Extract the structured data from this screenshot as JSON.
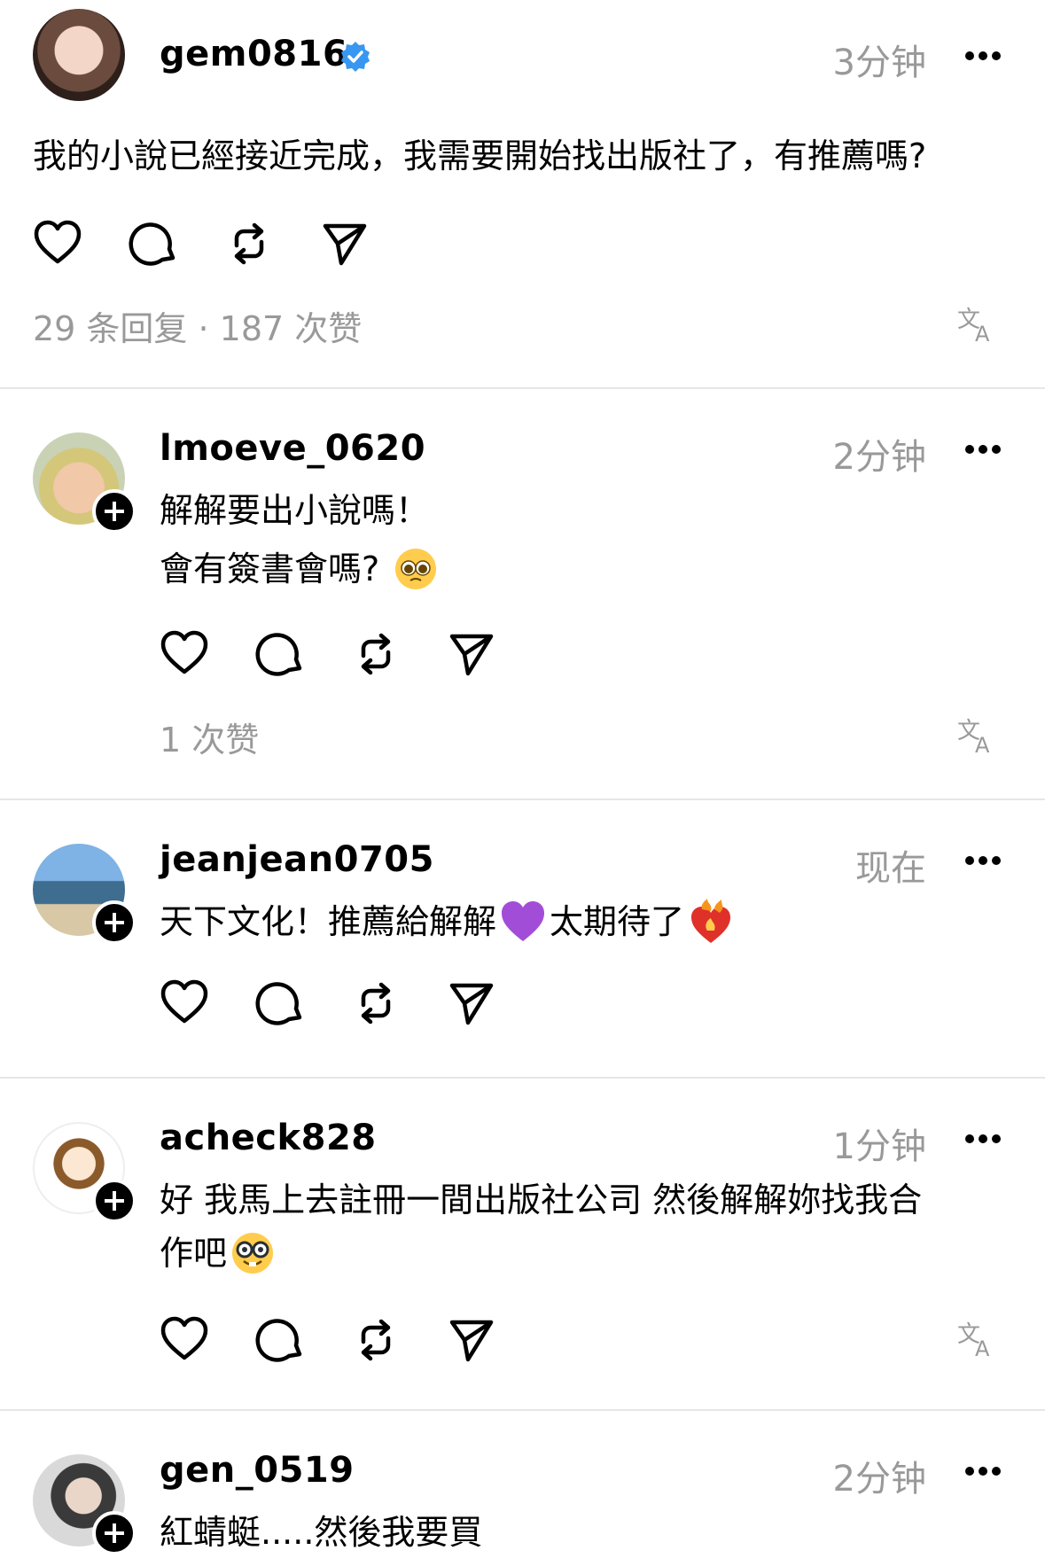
{
  "colors": {
    "verified": "#3897f0",
    "muted": "#999999",
    "divider": "#e6e6e6",
    "heart_purple": "#8a2be2",
    "heart_fire": "#e0302a"
  },
  "posts": [
    {
      "username": "gem0816",
      "time": "3分钟",
      "verified": true,
      "text": "我的小說已經接近完成，我需要開始找出版社了，有推薦嗎?",
      "stats": "29 条回复 · 187 次赞"
    },
    {
      "username": "lmoeve_0620",
      "time": "2分钟",
      "text_line1": "解解要出小說嗎！",
      "text_line2": "會有簽書會嗎?",
      "emoji": "pleading-face",
      "stats": "1 次赞"
    },
    {
      "username": "jeanjean0705",
      "time": "现在",
      "text_part1": "天下文化！推薦給解解",
      "text_part2": "太期待了",
      "emoji1": "purple-heart",
      "emoji2": "heart-on-fire"
    },
    {
      "username": "acheck828",
      "time": "1分钟",
      "text_line1": "好 我馬上去註冊一間出版社公司 然後解解妳找我合",
      "text_line2": "作吧",
      "emoji": "nerd-face"
    },
    {
      "username": "gen_0519",
      "time": "2分钟",
      "text": "紅蜻蜓.....然後我要買"
    }
  ],
  "icons": [
    "heart-icon",
    "comment-icon",
    "repost-icon",
    "share-icon",
    "translate-icon",
    "more-icon",
    "verified-icon",
    "follow-plus-icon"
  ]
}
